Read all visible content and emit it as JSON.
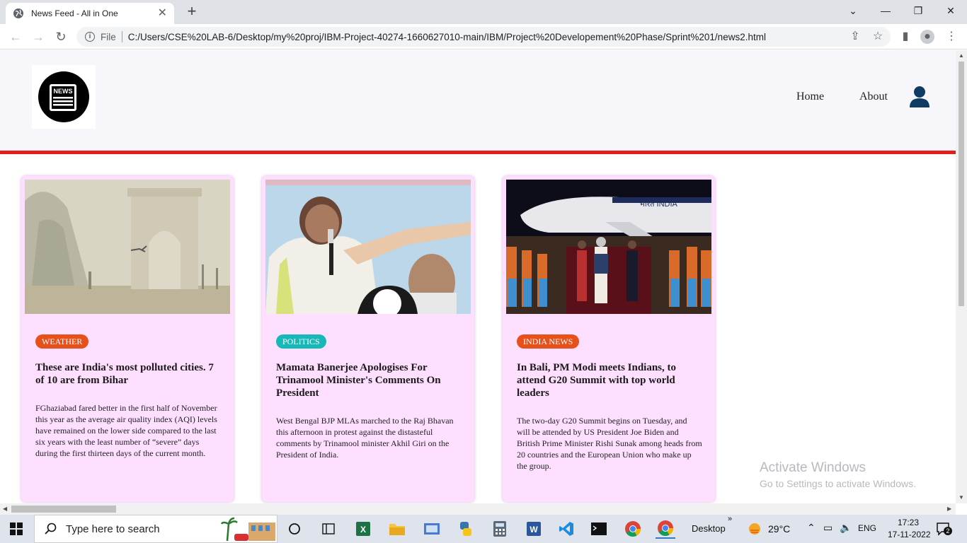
{
  "browser": {
    "tab_title": "News Feed - All in One",
    "address_scheme": "File",
    "address_url": "C:/Users/CSE%20LAB-6/Desktop/my%20proj/IBM-Project-40274-1660627010-main/IBM/Project%20Developement%20Phase/Sprint%201/news2.html"
  },
  "header": {
    "logo_text": "NEWS",
    "nav": {
      "home": "Home",
      "about": "About"
    }
  },
  "cards": [
    {
      "category": "WEATHER",
      "category_color": "#e8501a",
      "headline": "These are India's most polluted cities. 7 of 10 are from Bihar",
      "body": "FGhaziabad fared better in the first half of November this year as the average air quality index (AQI) levels have remained on the lower side compared to the last six years with the least number of “severe” days during the first thirteen days of the current month.",
      "image": "smog-india-gate"
    },
    {
      "category": "POLITICS",
      "category_color": "#17b8b8",
      "headline": "Mamata Banerjee Apologises For Trinamool Minister's Comments On President",
      "body": "West Bengal BJP MLAs marched to the Raj Bhavan this afternoon in protest against the distasteful comments by Trinamool minister Akhil Giri on the President of India.",
      "image": "mamata-speech"
    },
    {
      "category": "INDIA NEWS",
      "category_color": "#e8501a",
      "headline": "In Bali, PM Modi meets Indians, to attend G20 Summit with top world leaders",
      "body": "The two-day G20 Summit begins on Tuesday, and will be attended by US President Joe Biden and British Prime Minister Rishi Sunak among heads from 20 countries and the European Union who make up the group.",
      "image": "bali-arrival",
      "plane_text": "भारत INDIA"
    }
  ],
  "watermark": {
    "line1": "Activate Windows",
    "line2": "Go to Settings to activate Windows."
  },
  "taskbar": {
    "search_placeholder": "Type here to search",
    "desktop_label": "Desktop",
    "weather": "29°C",
    "language": "ENG",
    "time": "17:23",
    "date": "17-11-2022",
    "notification_count": "2"
  }
}
